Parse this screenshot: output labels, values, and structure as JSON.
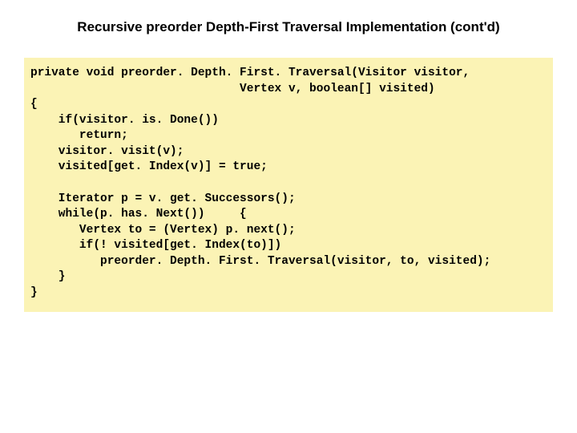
{
  "title": "Recursive preorder Depth-First Traversal Implementation (cont'd)",
  "code": "private void preorder. Depth. First. Traversal(Visitor visitor,\n                              Vertex v, boolean[] visited)\n{\n    if(visitor. is. Done())\n       return;\n    visitor. visit(v);\n    visited[get. Index(v)] = true;\n\n    Iterator p = v. get. Successors();\n    while(p. has. Next())     {\n       Vertex to = (Vertex) p. next();\n       if(! visited[get. Index(to)])\n          preorder. Depth. First. Traversal(visitor, to, visited);\n    }\n}"
}
